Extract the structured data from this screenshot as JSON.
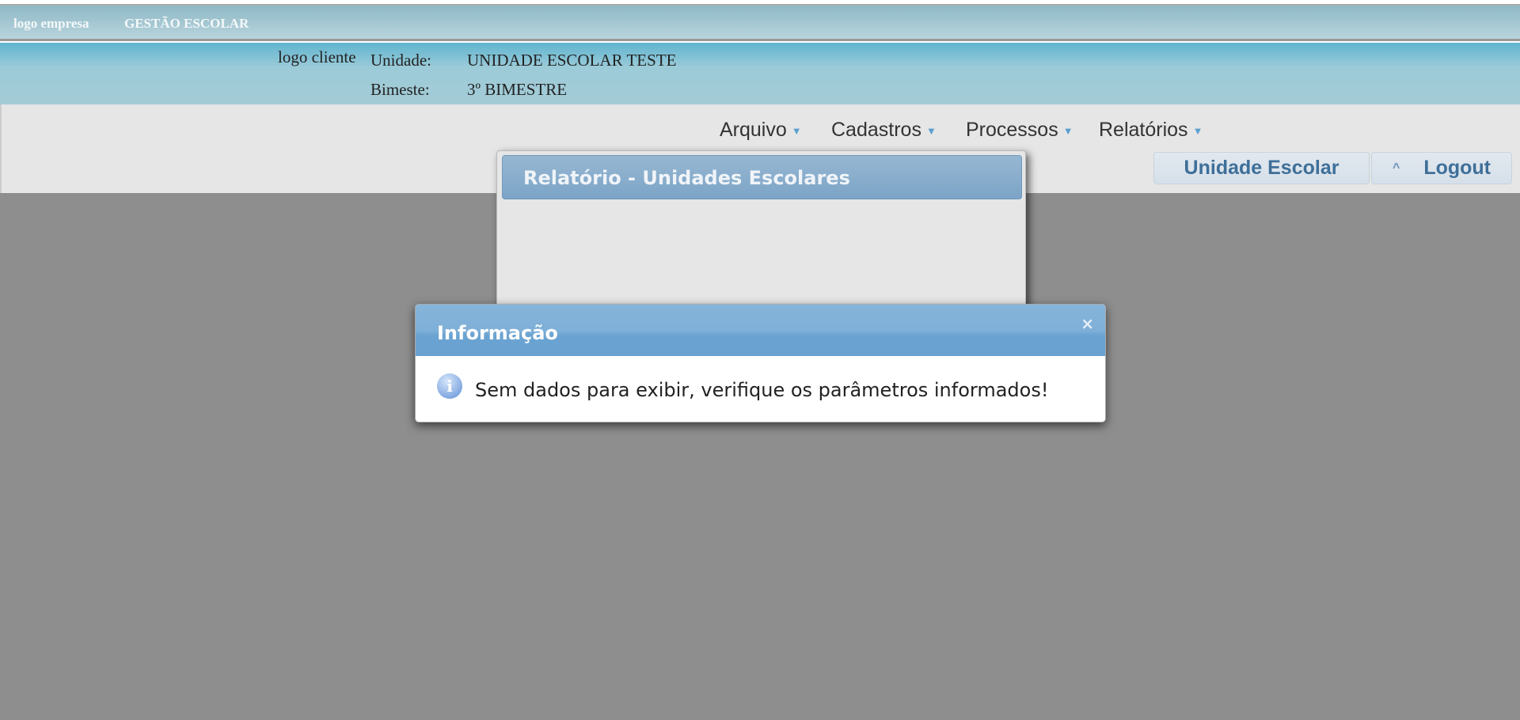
{
  "topbar": {
    "logo_empresa": "logo empresa",
    "app_title": "GESTÃO ESCOLAR"
  },
  "header": {
    "logo_cliente": "logo cliente",
    "unidade_label": "Unidade:",
    "unidade_value": "UNIDADE ESCOLAR TESTE",
    "bimestre_label": "Bimeste:",
    "bimestre_value": "3º BIMESTRE"
  },
  "menu": {
    "items": [
      {
        "label": "Arquivo"
      },
      {
        "label": "Cadastros"
      },
      {
        "label": "Processos"
      },
      {
        "label": "Relatórios"
      }
    ]
  },
  "buttons": {
    "unidade": "Unidade Escolar",
    "logout_icon": "^",
    "logout": "Logout"
  },
  "panel": {
    "title": "Relatório - Unidades Escolares"
  },
  "dialog": {
    "title": "Informação",
    "close": "×",
    "icon": "i",
    "message": "Sem dados para exibir, verifique os parâmetros informados!"
  }
}
